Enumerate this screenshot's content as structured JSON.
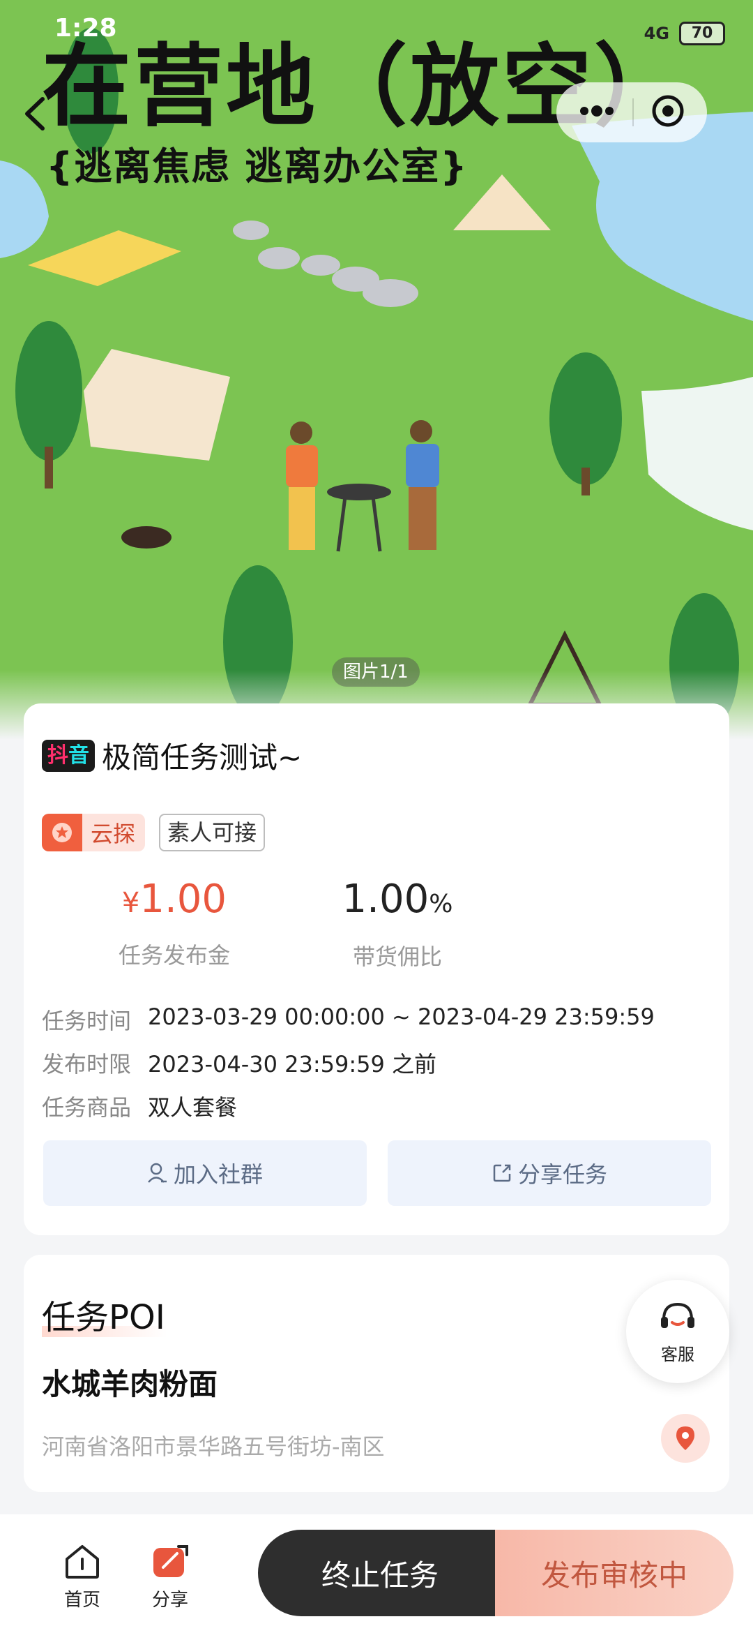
{
  "status_bar": {
    "time": "1:28",
    "network": "4G",
    "battery": "70"
  },
  "hero": {
    "title": "在营地（放空）",
    "subtitle": "{逃离焦虑 逃离办公室}",
    "image_counter": "图片1/1"
  },
  "task": {
    "platform_badge_left": "抖",
    "platform_badge_right": "音",
    "title": "极简任务测试~",
    "tags": {
      "cloud": "云探",
      "plain": "素人可接"
    },
    "fee": {
      "currency": "¥",
      "value": "1.00",
      "label": "任务发布金"
    },
    "rate": {
      "value": "1.00",
      "unit": "%",
      "label": "带货佣比"
    },
    "info": {
      "time_label": "任务时间",
      "time_value": "2023-03-29 00:00:00  ~  2023-04-29 23:59:59",
      "deadline_label": "发布时限",
      "deadline_value": "2023-04-30 23:59:59 之前",
      "product_label": "任务商品",
      "product_value": "双人套餐"
    },
    "buttons": {
      "join_group": "加入社群",
      "share_task": "分享任务"
    }
  },
  "poi": {
    "section_title": "任务POI",
    "name": "水城羊肉粉面",
    "address": "河南省洛阳市景华路五号街坊-南区"
  },
  "service": {
    "label": "客服"
  },
  "bottom_bar": {
    "home": "首页",
    "share": "分享",
    "end_task": "终止任务",
    "review": "发布审核中"
  },
  "colors": {
    "accent": "#e8563d",
    "dark_button": "#2e2e2e",
    "review_button": "#f7b8a8",
    "grass": "#7cc452"
  },
  "icons": [
    "back-arrow-icon",
    "more-dots-icon",
    "target-icon",
    "medal-icon",
    "user-icon",
    "share-external-icon",
    "headset-icon",
    "location-pin-icon",
    "home-icon",
    "share-icon"
  ]
}
